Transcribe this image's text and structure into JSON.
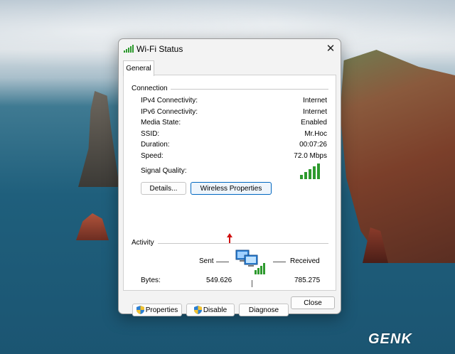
{
  "window": {
    "title": "Wi-Fi Status",
    "close_glyph": "✕",
    "tab": "General"
  },
  "connection": {
    "group_label": "Connection",
    "rows": [
      {
        "label": "IPv4 Connectivity:",
        "value": "Internet"
      },
      {
        "label": "IPv6 Connectivity:",
        "value": "Internet"
      },
      {
        "label": "Media State:",
        "value": "Enabled"
      },
      {
        "label": "SSID:",
        "value": "Mr.Hoc"
      },
      {
        "label": "Duration:",
        "value": "00:07:26"
      },
      {
        "label": "Speed:",
        "value": "72.0 Mbps"
      }
    ],
    "signal_label": "Signal Quality:",
    "signal_bars": 5,
    "details_button": "Details...",
    "wireless_button": "Wireless Properties"
  },
  "activity": {
    "group_label": "Activity",
    "sent_label": "Sent",
    "received_label": "Received",
    "bytes_label": "Bytes:",
    "bytes_sent": "549.626",
    "bytes_received": "785.275"
  },
  "buttons": {
    "properties": "Properties",
    "disable": "Disable",
    "diagnose": "Diagnose",
    "close": "Close"
  },
  "watermark": "GENK",
  "colors": {
    "signal_green": "#2e9a2e",
    "accent_blue": "#0067c0",
    "arrow_red": "#d01010"
  }
}
